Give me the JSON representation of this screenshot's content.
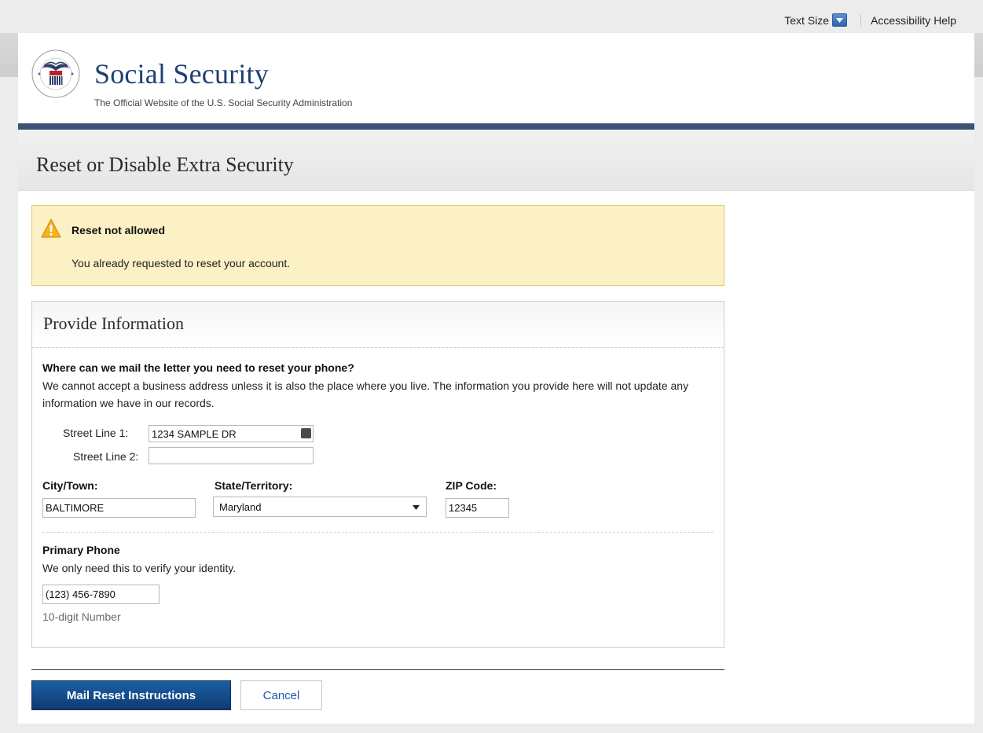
{
  "topbar": {
    "text_size_label": "Text Size",
    "accessibility_label": "Accessibility Help"
  },
  "header": {
    "brand_title": "Social Security",
    "brand_subtitle": "The Official Website of the U.S. Social Security Administration",
    "seal_text": "SOCIAL SECURITY ADMINISTRATION · USA"
  },
  "page": {
    "title": "Reset or Disable Extra Security"
  },
  "alert": {
    "title": "Reset not allowed",
    "message": "You already requested to reset your account."
  },
  "form": {
    "heading": "Provide Information",
    "question": "Where can we mail the letter you need to reset your phone?",
    "description": "We cannot accept a business address unless it is also the place where you live. The information you provide here will not update any information we have in our records.",
    "street1_label": "Street Line 1:",
    "street1_value": "1234 SAMPLE DR",
    "street2_label": "Street Line 2:",
    "street2_value": "",
    "city_label": "City/Town:",
    "city_value": "BALTIMORE",
    "state_label": "State/Territory:",
    "state_value": "Maryland",
    "zip_label": "ZIP Code:",
    "zip_value": "12345",
    "phone_label": "Primary Phone",
    "phone_desc": "We only need this to verify your identity.",
    "phone_value": "(123) 456-7890",
    "phone_hint": "10-digit Number"
  },
  "actions": {
    "submit_label": "Mail Reset Instructions",
    "cancel_label": "Cancel"
  },
  "colors": {
    "brand_navy": "#1f3f73",
    "nav_bar": "#3c5276",
    "alert_bg": "#fbf1c4",
    "primary_button": "#0d3a72"
  }
}
